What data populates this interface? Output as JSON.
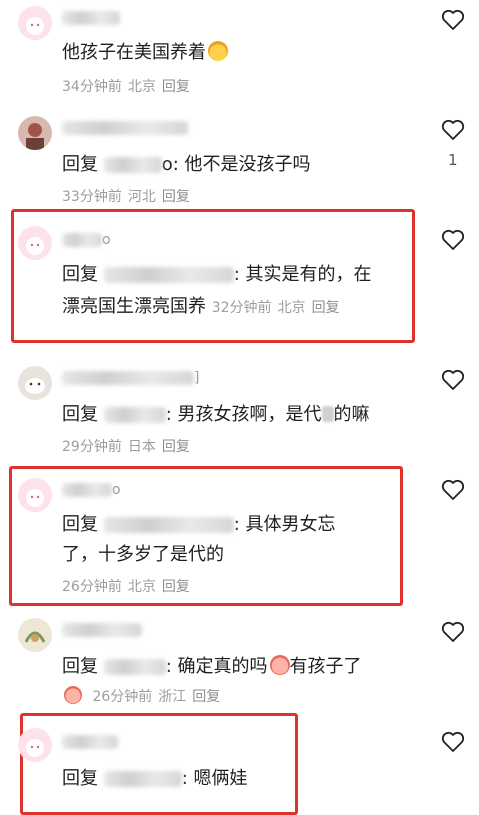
{
  "comments": [
    {
      "text": "他孩子在美国养着",
      "time": "34分钟前",
      "location": "北京",
      "reply_btn": "回复"
    },
    {
      "reply_prefix": "回复",
      "name_tail": "o",
      "text": ": 他不是没孩子吗",
      "time": "33分钟前",
      "location": "河北",
      "reply_btn": "回复",
      "likes": "1"
    },
    {
      "name_tail": "o",
      "reply_prefix": "回复",
      "text": ": 其实是有的，在",
      "text2": "漂亮国生漂亮国养",
      "time": "32分钟前",
      "location": "北京",
      "reply_btn": "回复"
    },
    {
      "name_tail": "]",
      "reply_prefix": "回复",
      "text": ": 男孩女孩啊，是代",
      "text_end": "的嘛",
      "time": "29分钟前",
      "location": "日本",
      "reply_btn": "回复"
    },
    {
      "name_tail": "o",
      "reply_prefix": "回复",
      "text": ": 具体男女忘",
      "text2": "了，十多岁了是代的",
      "time": "26分钟前",
      "location": "北京",
      "reply_btn": "回复"
    },
    {
      "reply_prefix": "回复",
      "text": ": 确定真的吗",
      "text_end": "有孩子了",
      "time": "26分钟前",
      "location": "浙江",
      "reply_btn": "回复"
    },
    {
      "reply_prefix": "回复",
      "text": ": 嗯俩娃"
    }
  ],
  "colors": {
    "highlight": "#e0322c",
    "meta": "#9d9d9d",
    "text": "#1f1f1f"
  },
  "icons": {
    "like": "heart-outline-icon"
  }
}
